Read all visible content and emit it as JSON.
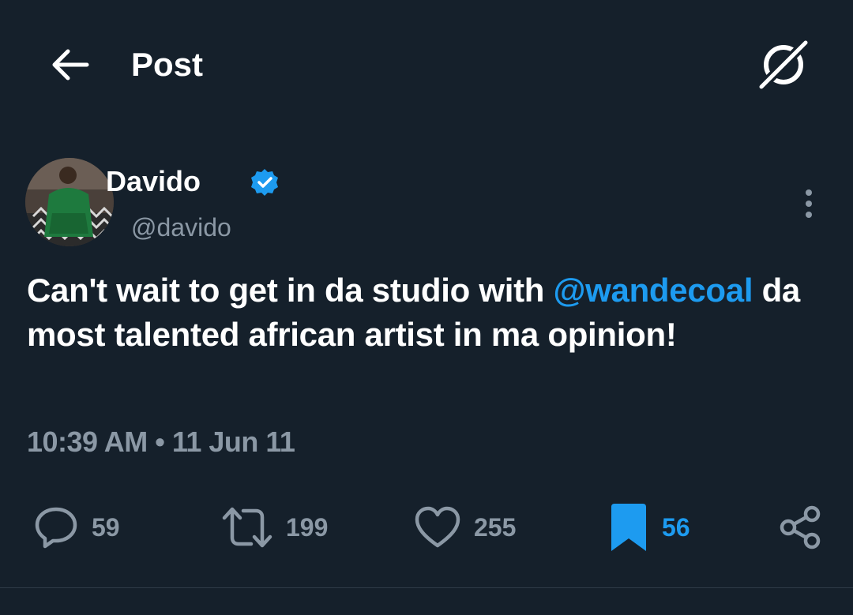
{
  "header": {
    "title": "Post",
    "back_icon": "arrow-left-icon",
    "grok_icon": "grok-icon"
  },
  "tweet": {
    "author": {
      "display_name": "Davido",
      "handle": "@davido",
      "verified": true
    },
    "text_before_mention": "Can't wait to get in da studio with ",
    "mention": "@wandecoal",
    "text_after_mention": " da most talented african artist in ma opinion!",
    "timestamp": "10:39 AM • 11 Jun 11",
    "stats": {
      "replies": "59",
      "reposts": "199",
      "likes": "255",
      "bookmarks": "56"
    },
    "bookmarked": true
  },
  "colors": {
    "background": "#15202b",
    "text_primary": "#ffffff",
    "text_secondary": "#8b98a5",
    "accent": "#1d9bf0"
  }
}
